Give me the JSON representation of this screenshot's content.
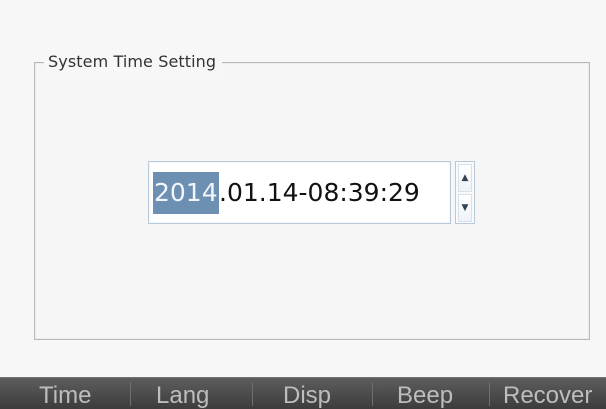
{
  "settings": {
    "group_title": "System Time Setting",
    "datetime": {
      "selected_segment": "2014",
      "remaining_text": ".01.14-08:39:29"
    },
    "spinner": {
      "up_symbol": "▲",
      "down_symbol": "▼"
    }
  },
  "bottom_tabs": {
    "time": "Time",
    "lang": "Lang",
    "disp": "Disp",
    "beep": "Beep",
    "recover": "Recover"
  },
  "colors": {
    "selection_background": "#6d8fb2",
    "bottom_bar": "#4b4b4b",
    "tab_text": "#bdbdbd"
  },
  "icons": {
    "spinner_up": "arrow-up-icon",
    "spinner_down": "arrow-down-icon"
  }
}
